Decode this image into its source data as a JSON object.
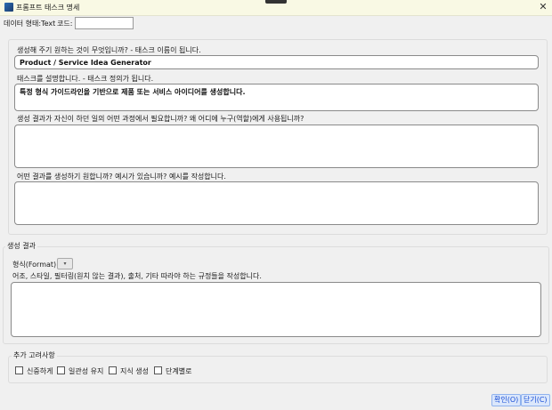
{
  "window": {
    "title": "프롬프트 태스크 명세",
    "close_glyph": "✕"
  },
  "header": {
    "data_type_label": "데이터 형태:Text",
    "code_label": "코드:",
    "code_value": ""
  },
  "task": {
    "name_question": "생성해 주기 원하는 것이 무엇입니까? - 태스크 이름이 됩니다.",
    "name_value": "Product / Service Idea Generator",
    "description_question": "태스크를 설명합니다. - 태스크 정의가 됩니다.",
    "description_value": "특정 형식 가이드라인을 기반으로 제품 또는 서비스 아이디어를 생성합니다.",
    "purpose_question": "생성 결과가 자신이 하던 일의 어떤 과정에서 필요합니까? 왜 어디에 누구(역할)에게 사용됩니까?",
    "purpose_value": "",
    "example_question": "어떤 결과를 생성하기 원합니까? 예시가 있습니까? 예시를 작성합니다.",
    "example_value": ""
  },
  "output": {
    "legend": "생성 결과",
    "format_label": "형식(Format):",
    "format_value": "",
    "rules_question": "어조, 스타일, 필터링(원치 않는 결과), 출처, 기타 따라야 하는 규정들을 작성합니다.",
    "rules_value": ""
  },
  "extra": {
    "legend": "추가 고려사항",
    "options": [
      {
        "label": "신중하게",
        "checked": false
      },
      {
        "label": "일관성 유지",
        "checked": false
      },
      {
        "label": "지식 생성",
        "checked": false
      },
      {
        "label": "단계별로",
        "checked": false
      }
    ]
  },
  "buttons": {
    "ok": "확인(O)",
    "close": "닫기(C)"
  }
}
